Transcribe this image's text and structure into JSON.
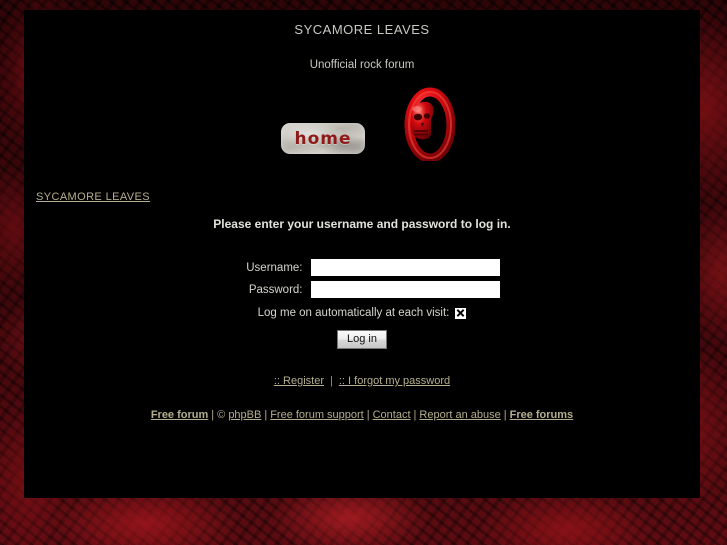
{
  "background": {
    "page_color": "#300508",
    "accent_red": "#b01c22",
    "panel_color": "#000000"
  },
  "header": {
    "site_title": "SYCAMORE LEAVES",
    "site_description": "Unofficial rock forum",
    "home_button_label": "home",
    "home_button_icon": "home-button-image",
    "logo_icon": "red-skull-logo"
  },
  "breadcrumb": {
    "items": [
      {
        "label": "SYCAMORE LEAVES",
        "link_color": "#b5ae8e"
      }
    ]
  },
  "login": {
    "heading": "Please enter your username and password to log in.",
    "username_label": "Username:",
    "username_value": "",
    "username_placeholder": "",
    "password_label": "Password:",
    "password_value": "",
    "password_placeholder": "",
    "autologin_label": "Log me on automatically at each visit:",
    "autologin_checked": true,
    "submit_label": "Log in"
  },
  "secondary_links": {
    "register": ":: Register",
    "separator": "|",
    "forgot_password": ":: I forgot my password"
  },
  "footer": {
    "free_forum": "Free forum",
    "sep1": "|",
    "copyright_symbol": "©",
    "phpbb": "phpBB",
    "sep2": "|",
    "free_forum_support": "Free forum support",
    "sep3": "|",
    "contact": "Contact",
    "sep4": "|",
    "report_abuse": "Report an abuse",
    "sep5": "|",
    "free_forums": "Free forums"
  }
}
